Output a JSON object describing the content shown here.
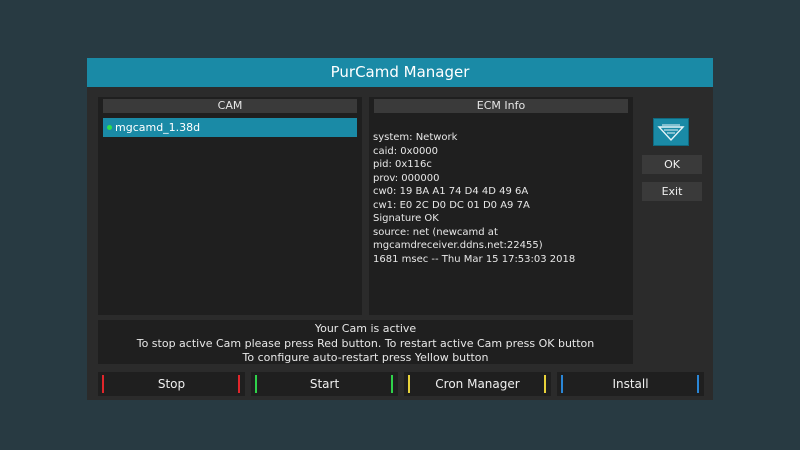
{
  "window": {
    "title": "PurCamd Manager"
  },
  "cam_panel": {
    "header": "CAM",
    "items": [
      {
        "name": "mgcamd_1.38d",
        "active": true
      }
    ]
  },
  "ecm_panel": {
    "header": "ECM Info",
    "lines": [
      "system: Network",
      "caid: 0x0000",
      "pid: 0x116c",
      "prov: 000000",
      "cw0: 19 BA A1 74 D4 4D 49 6A",
      "cw1: E0 2C D0 DC 01 D0 A9 7A",
      "Signature OK",
      "source: net (newcamd at",
      "mgcamdreceiver.ddns.net:22455)",
      "1681 msec -- Thu Mar 15 17:53:03 2018"
    ]
  },
  "side_buttons": {
    "ok": "OK",
    "exit": "Exit",
    "logo_icon": "purcamd-logo-icon"
  },
  "status": {
    "lines": [
      "Your Cam is active",
      "To stop active Cam please press Red button. To restart active Cam press OK button",
      "To configure auto-restart press Yellow button"
    ]
  },
  "buttons": [
    {
      "label": "Stop",
      "color": "#e0262b"
    },
    {
      "label": "Start",
      "color": "#2fd24a"
    },
    {
      "label": "Cron Manager",
      "color": "#e8d23a"
    },
    {
      "label": "Install",
      "color": "#2a86d6"
    }
  ],
  "colors": {
    "accent": "#1a8aa6",
    "background": "#283a42",
    "active_dot": "#2ee04a"
  }
}
